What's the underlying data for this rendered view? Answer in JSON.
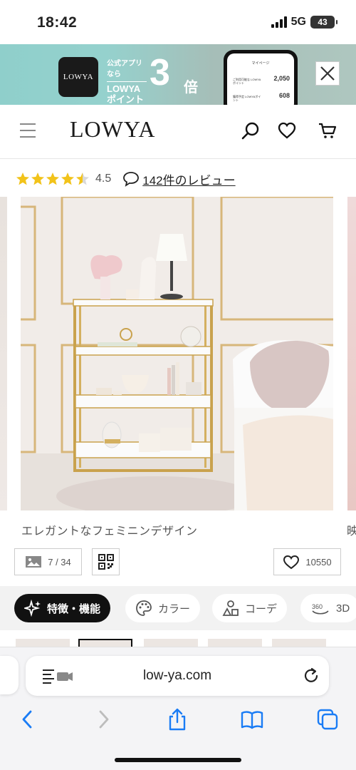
{
  "status_bar": {
    "time": "18:42",
    "network": "5G",
    "battery": "43"
  },
  "banner": {
    "logo": "LOWYA",
    "sub": "公式アプリなら",
    "line1": "LOWYA",
    "line2": "ポイント",
    "big_number": "3",
    "suffix": "倍",
    "phone": {
      "title": "マイページ",
      "row1_label": "ご利用可能な LOWYAポイント",
      "row1_value": "2,050",
      "row2_label": "獲得予定 LOWYAポイント",
      "row2_value": "608"
    }
  },
  "header": {
    "logo": "LOWYA"
  },
  "rating": {
    "value": "4.5",
    "stars": 4.5,
    "review_link": "142件のレビュー"
  },
  "gallery": {
    "caption": "エレガントなフェミニンデザイン",
    "next_caption": "映"
  },
  "controls": {
    "image_counter": "7 / 34",
    "favorite_count": "10550"
  },
  "tabs": [
    {
      "label": "特徴・機能",
      "icon": "sparkle-icon",
      "active": true
    },
    {
      "label": "カラー",
      "icon": "palette-icon",
      "active": false
    },
    {
      "label": "コーデ",
      "icon": "shapes-icon",
      "active": false
    },
    {
      "label": "3D",
      "icon": "360-icon",
      "active": false
    }
  ],
  "safari": {
    "url": "low-ya.com"
  },
  "colors": {
    "banner_bg": "#8fcfcb",
    "star": "#f2c31a",
    "active_tab": "#111111",
    "toolbar_blue": "#1a7cf5"
  }
}
